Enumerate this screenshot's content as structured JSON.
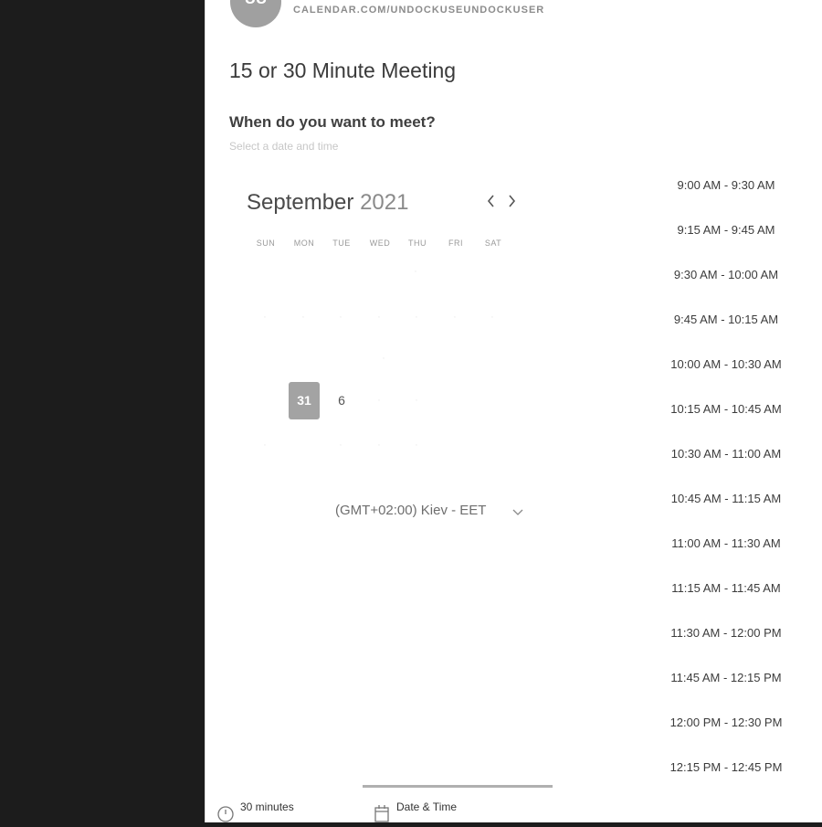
{
  "header": {
    "avatar_initials": "UU",
    "url": "CALENDAR.COM/UNDOCKUSEUNDOCKUSER"
  },
  "event": {
    "title": "15 or 30 Minute Meeting",
    "question": "When do you want to meet?",
    "subtitle": "Select a date and time"
  },
  "calendar": {
    "month": "September",
    "year": "2021",
    "prev_icon": "chevron-left-icon",
    "next_icon": "chevron-right-icon",
    "weekdays": [
      "SUN",
      "MON",
      "TUE",
      "WED",
      "THU",
      "FRI",
      "SAT"
    ],
    "selected_day": "31",
    "next_day": "6"
  },
  "timezone": {
    "label": "(GMT+02:00) Kiev - EET",
    "icon": "chevron-down-icon"
  },
  "time_slots": [
    "9:00 AM - 9:30 AM",
    "9:15 AM - 9:45 AM",
    "9:30 AM - 10:00 AM",
    "9:45 AM - 10:15 AM",
    "10:00 AM - 10:30 AM",
    "10:15 AM - 10:45 AM",
    "10:30 AM - 11:00 AM",
    "10:45 AM - 11:15 AM",
    "11:00 AM - 11:30 AM",
    "11:15 AM - 11:45 AM",
    "11:30 AM - 12:00 PM",
    "11:45 AM - 12:15 PM",
    "12:00 PM - 12:30 PM",
    "12:15 PM - 12:45 PM"
  ],
  "footer": {
    "duration_label": "30 minutes",
    "duration_icon": "clock-icon",
    "date_time_label": "Date & Time",
    "date_time_icon": "calendar-icon"
  },
  "colors": {
    "selected_day_bg": "#a3a3a3",
    "sidebar_bg": "#1c1c1c"
  }
}
